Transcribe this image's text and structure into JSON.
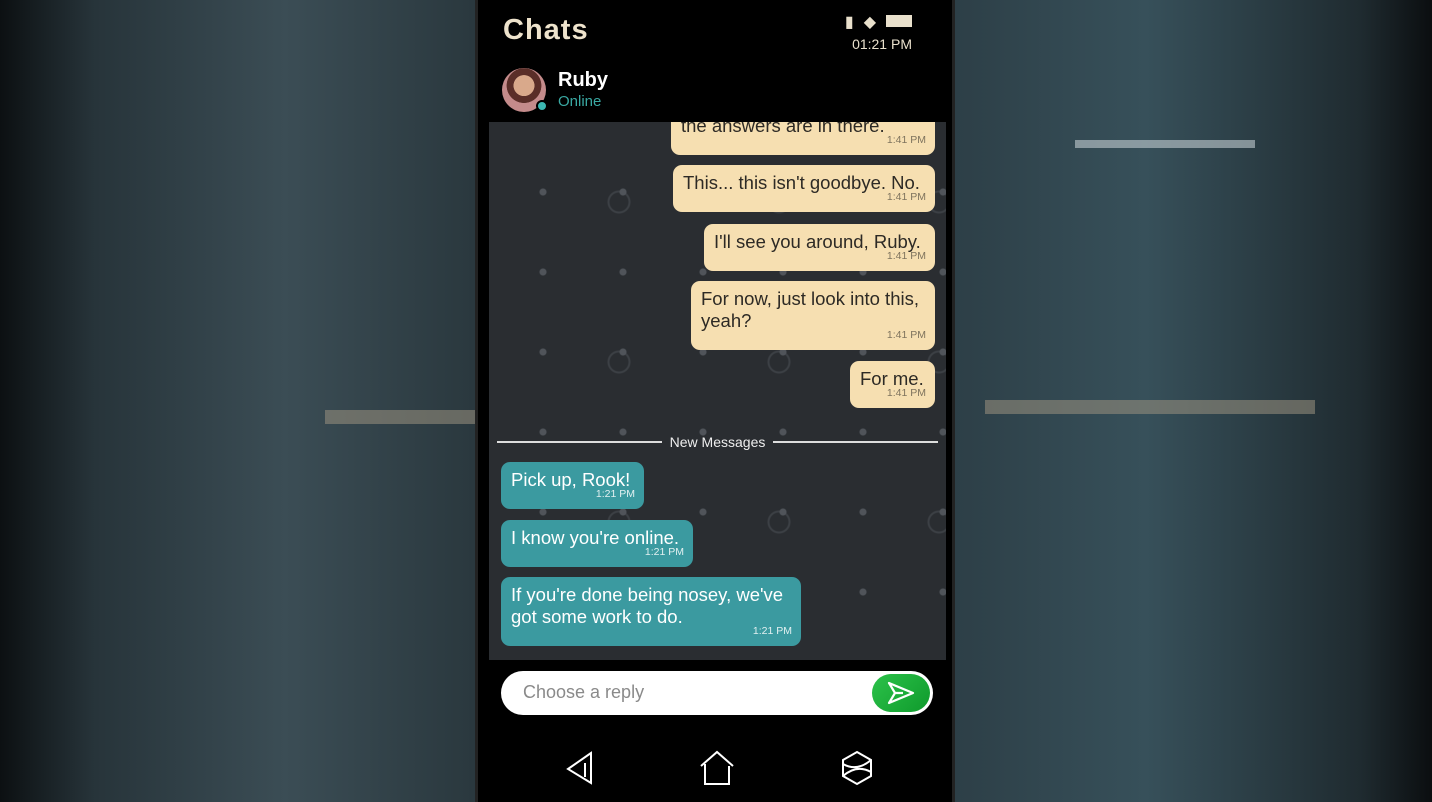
{
  "header": {
    "title": "Chats",
    "time": "01:21 PM",
    "status_icons": [
      "signal-icon",
      "wifi-icon",
      "battery-icon"
    ]
  },
  "contact": {
    "name": "Ruby",
    "status": "Online",
    "status_color": "#3aa9a3"
  },
  "messages": [
    {
      "direction": "outgoing",
      "text": "the answers are in there.",
      "time": "1:41 PM"
    },
    {
      "direction": "outgoing",
      "text": "This... this isn't goodbye. No.",
      "time": "1:41 PM"
    },
    {
      "direction": "outgoing",
      "text": "I'll see you around, Ruby.",
      "time": "1:41 PM"
    },
    {
      "direction": "outgoing",
      "text": "For now, just look into this, yeah?",
      "time": "1:41 PM"
    },
    {
      "direction": "outgoing",
      "text": "For me.",
      "time": "1:41 PM"
    },
    {
      "direction": "incoming",
      "text": "Pick up, Rook!",
      "time": "1:21 PM"
    },
    {
      "direction": "incoming",
      "text": "I know you're online.",
      "time": "1:21 PM"
    },
    {
      "direction": "incoming",
      "text": "If you're done being nosey, we've got some work to do.",
      "time": "1:21 PM"
    }
  ],
  "divider_label": "New Messages",
  "reply": {
    "placeholder": "Choose a reply",
    "value": ""
  },
  "colors": {
    "outgoing_bubble": "#f6dfb1",
    "incoming_bubble": "#3b9aa0",
    "send_button": "#1fae3b"
  }
}
